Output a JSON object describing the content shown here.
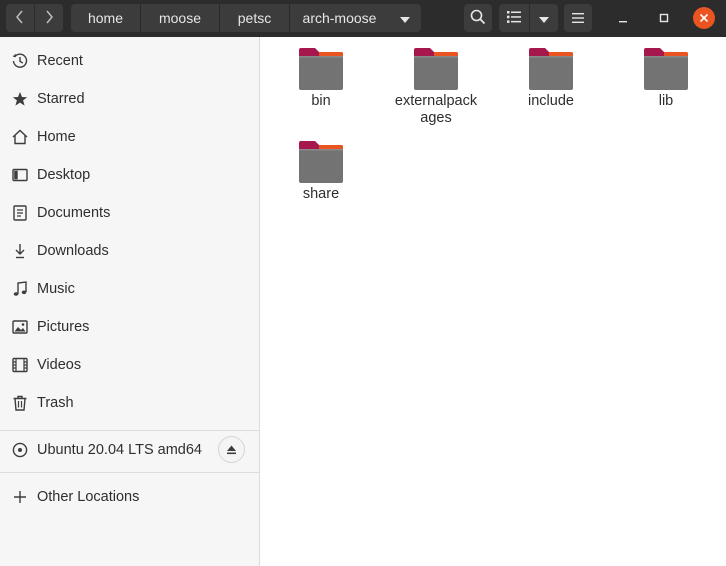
{
  "window": {
    "breadcrumbs": [
      "home",
      "moose",
      "petsc",
      "arch-moose"
    ],
    "icons": {
      "back": "chevron-left-icon",
      "forward": "chevron-right-icon",
      "path_menu": "triangle-down-icon",
      "search": "search-icon",
      "view": "list-view-icon",
      "view_menu": "triangle-down-icon",
      "menu": "hamburger-menu-icon",
      "minimize": "minimize-icon",
      "maximize": "maximize-icon",
      "close": "close-icon"
    },
    "close_color": "#e95420"
  },
  "sidebar": {
    "places": [
      {
        "label": "Recent",
        "icon": "clock-icon"
      },
      {
        "label": "Starred",
        "icon": "star-icon"
      },
      {
        "label": "Home",
        "icon": "home-icon"
      },
      {
        "label": "Desktop",
        "icon": "desktop-icon"
      },
      {
        "label": "Documents",
        "icon": "document-icon"
      },
      {
        "label": "Downloads",
        "icon": "download-icon"
      },
      {
        "label": "Music",
        "icon": "music-icon"
      },
      {
        "label": "Pictures",
        "icon": "picture-icon"
      },
      {
        "label": "Videos",
        "icon": "film-icon"
      },
      {
        "label": "Trash",
        "icon": "trash-icon"
      }
    ],
    "device": {
      "label": "Ubuntu 20.04 LTS amd64",
      "icon": "disc-icon",
      "eject_icon": "eject-icon"
    },
    "other": {
      "label": "Other Locations",
      "icon": "plus-icon"
    }
  },
  "folders": [
    {
      "name": "bin"
    },
    {
      "name": "externalpackages"
    },
    {
      "name": "include"
    },
    {
      "name": "lib"
    },
    {
      "name": "share"
    }
  ],
  "colors": {
    "folder_body": "#737373",
    "folder_tab": "#a6184d",
    "folder_accent": "#e95420"
  }
}
